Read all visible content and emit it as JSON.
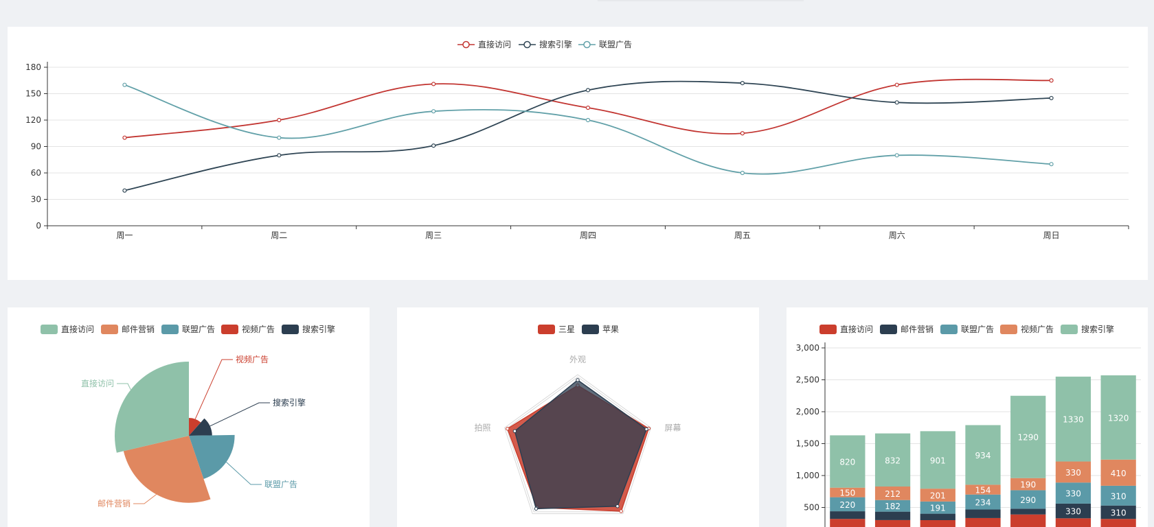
{
  "colors": {
    "line": [
      "#c23531",
      "#2f4554",
      "#61a0a8"
    ],
    "pie": [
      "#8fc1a9",
      "#e0875f",
      "#5b9aa8",
      "#cb3e2d",
      "#2c3e50"
    ],
    "radar": [
      "#cb3e2d",
      "#2c3e50"
    ],
    "bar": [
      "#cb3e2d",
      "#2c3e50",
      "#5b9aa8",
      "#e0875f",
      "#8fc1a9"
    ],
    "grid": "#e3e3e3",
    "axis": "#333333"
  },
  "chart_data": [
    {
      "type": "line",
      "smooth": true,
      "categories": [
        "周一",
        "周二",
        "周三",
        "周四",
        "周五",
        "周六",
        "周日"
      ],
      "ylim": [
        0,
        180
      ],
      "yticks": [
        "0",
        "30",
        "60",
        "90",
        "120",
        "150",
        "180"
      ],
      "legend": {
        "position": "top-center"
      },
      "series": [
        {
          "name": "直接访问",
          "values": [
            100,
            120,
            161,
            134,
            105,
            160,
            165
          ]
        },
        {
          "name": "搜索引擎",
          "values": [
            40,
            80,
            91,
            154,
            162,
            140,
            145
          ]
        },
        {
          "name": "联盟广告",
          "values": [
            160,
            100,
            130,
            120,
            60,
            80,
            70
          ]
        }
      ]
    },
    {
      "type": "pie",
      "rose": true,
      "legend": {
        "position": "top-center"
      },
      "slices": [
        {
          "name": "直接访问",
          "value": 335
        },
        {
          "name": "邮件营销",
          "value": 310
        },
        {
          "name": "联盟广告",
          "value": 234
        },
        {
          "name": "视频广告",
          "value": 135
        },
        {
          "name": "搜索引擎",
          "value": 154
        }
      ],
      "legend_items": [
        "直接访问",
        "邮件营销",
        "联盟广告",
        "视频广告",
        "搜索引擎"
      ]
    },
    {
      "type": "radar",
      "legend": {
        "position": "top-center"
      },
      "indicators": [
        "外观",
        "屏幕",
        "拍照"
      ],
      "series": [
        {
          "name": "三星",
          "values": [
            0.86,
            0.97,
            0.96,
            0.9,
            0.96
          ]
        },
        {
          "name": "苹果",
          "values": [
            0.93,
            0.94,
            0.88,
            0.92,
            0.86
          ]
        }
      ]
    },
    {
      "type": "bar",
      "stacked": true,
      "legend": {
        "position": "top-center"
      },
      "ylim": [
        0,
        3000
      ],
      "yticks": [
        "500",
        "1,000",
        "1,500",
        "2,000",
        "2,500",
        "3,000"
      ],
      "series": [
        {
          "name": "直接访问",
          "values": [
            320,
            302,
            301,
            334,
            390,
            330,
            320
          ]
        },
        {
          "name": "邮件营销",
          "values": [
            120,
            132,
            101,
            134,
            90,
            230,
            210
          ]
        },
        {
          "name": "联盟广告",
          "values": [
            220,
            182,
            191,
            234,
            290,
            330,
            310
          ]
        },
        {
          "name": "视频广告",
          "values": [
            150,
            212,
            201,
            154,
            190,
            330,
            410
          ]
        },
        {
          "name": "搜索引擎",
          "values": [
            820,
            832,
            901,
            934,
            1290,
            1330,
            1320
          ]
        }
      ],
      "visible_labels": [
        [
          "",
          "220",
          "150",
          "820"
        ],
        [
          "",
          "182",
          "212",
          "832"
        ],
        [
          "",
          "191",
          "201",
          "901"
        ],
        [
          "",
          "234",
          "154",
          "934"
        ],
        [
          "",
          "290",
          "190",
          "1290"
        ],
        [
          "330",
          "330",
          "330",
          "1330"
        ],
        [
          "310",
          "310",
          "410",
          "1320"
        ]
      ]
    }
  ]
}
